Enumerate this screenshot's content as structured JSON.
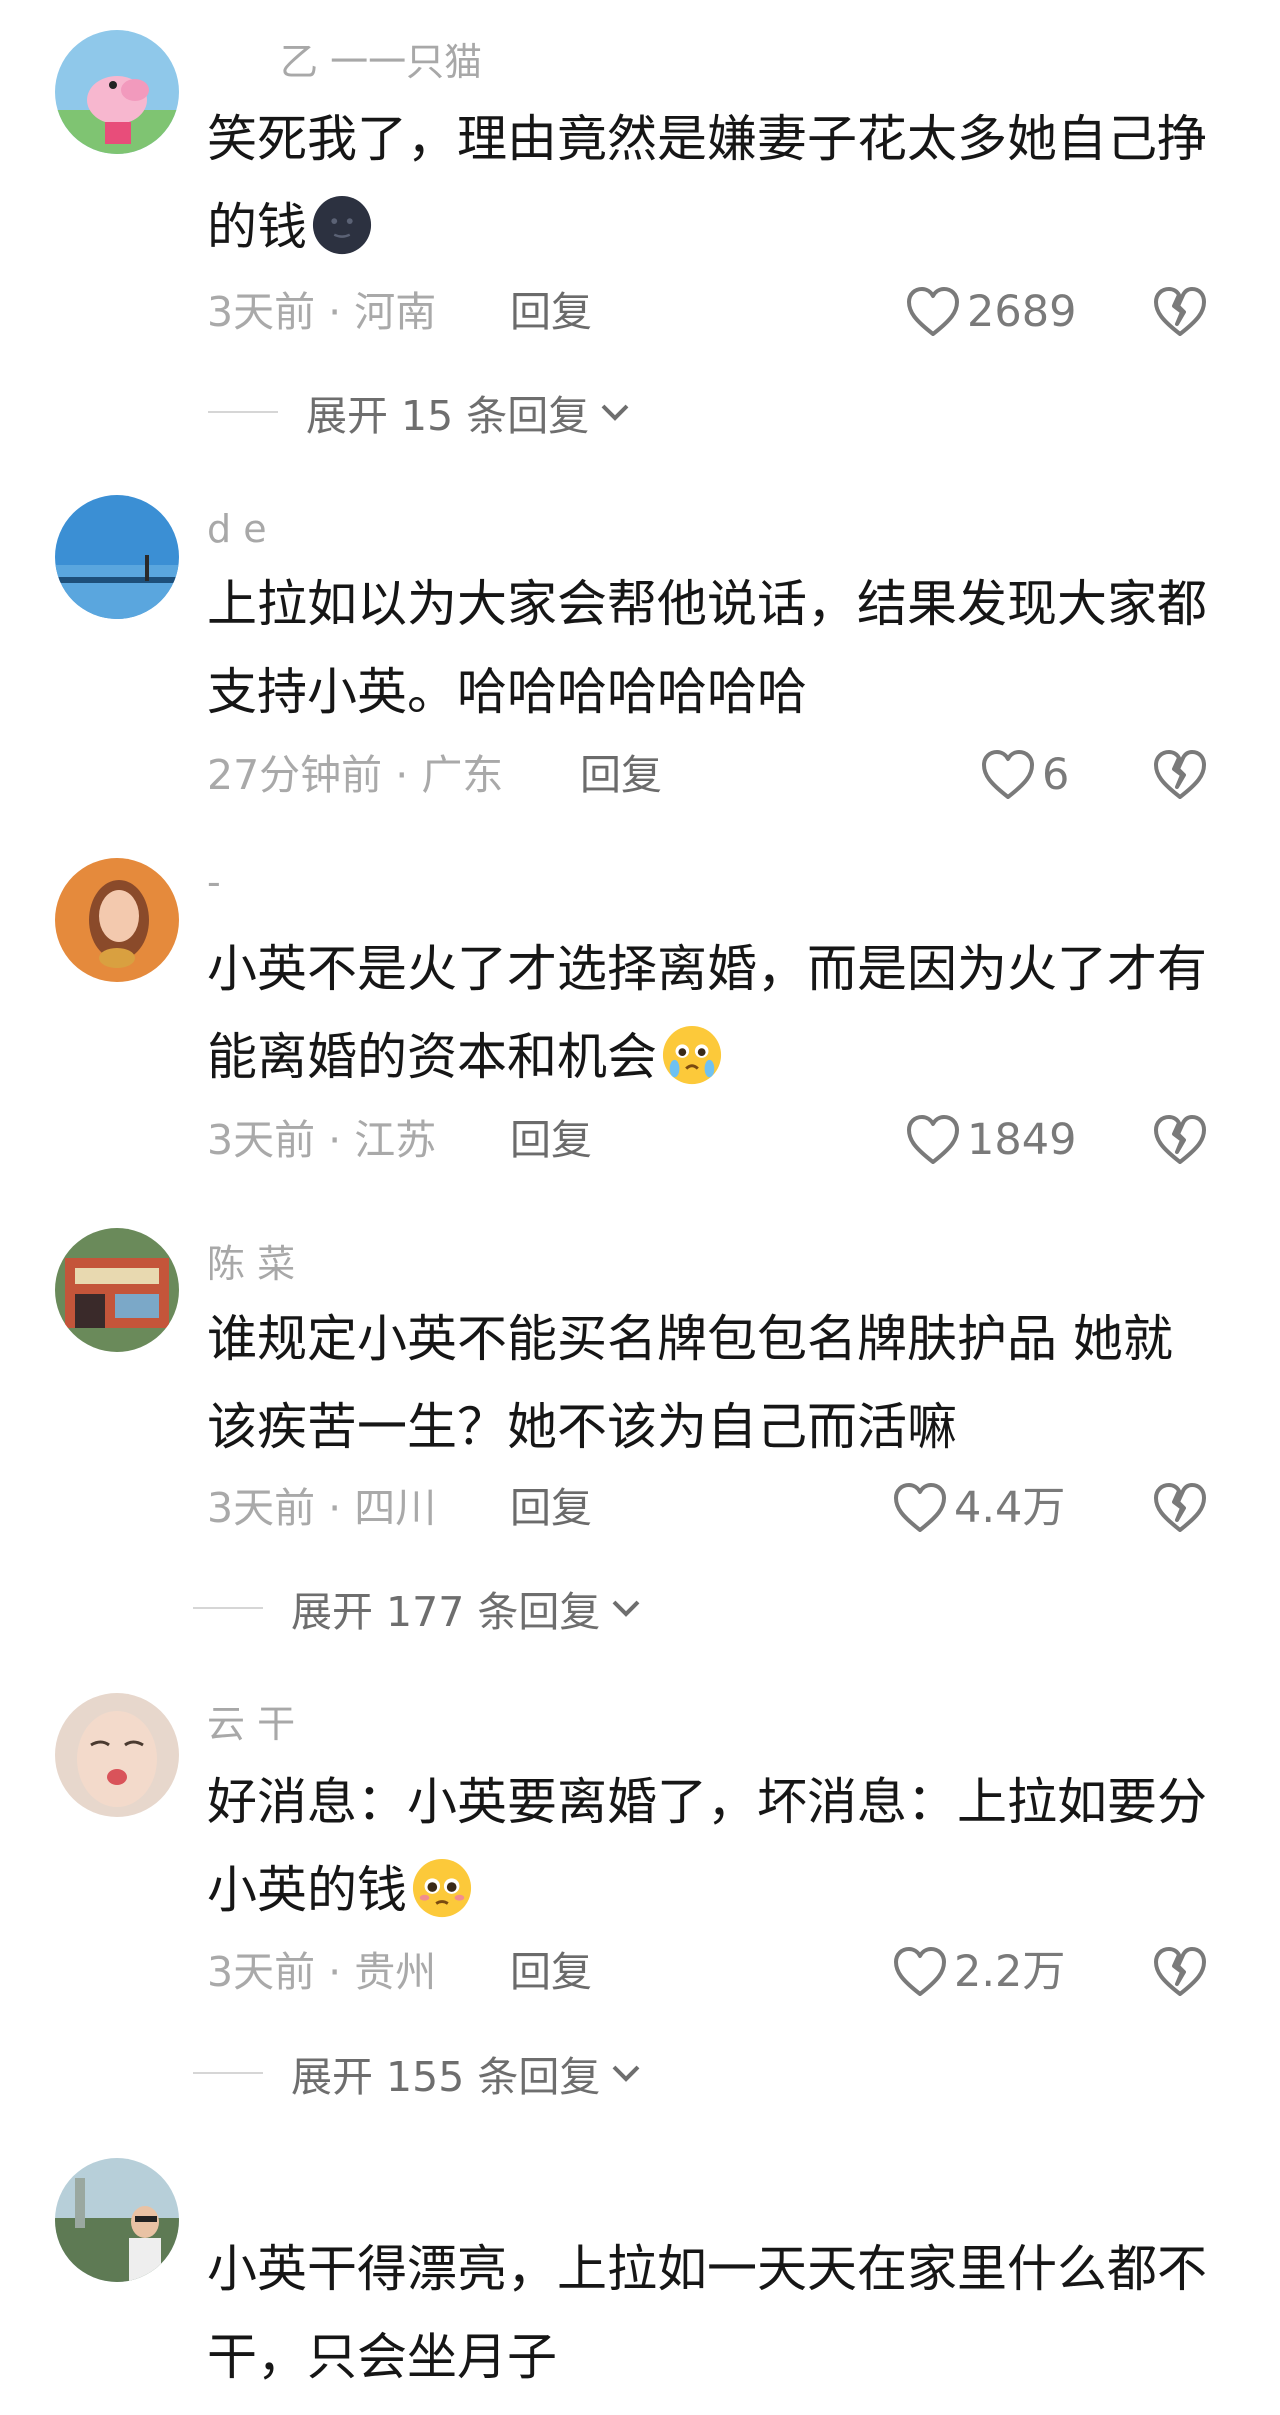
{
  "comments": [
    {
      "username": "乙 一一只猫",
      "text": "笑死我了，理由竟然是嫌妻子花太多她自己挣的钱",
      "emoji": "new-moon-face",
      "time": "3天前",
      "location": "河南",
      "reply_label": "回复",
      "likes": "2689",
      "expand_label": "展开 15 条回复"
    },
    {
      "username": "d e",
      "text": "上拉如以为大家会帮他说话，结果发现大家都支持小英。哈哈哈哈哈哈哈",
      "time": "27分钟前",
      "location": "广东",
      "reply_label": "回复",
      "likes": "6"
    },
    {
      "username": "-",
      "text": "小英不是火了才选择离婚，而是因为火了才有能离婚的资本和机会",
      "emoji": "crying-pleading-face",
      "time": "3天前",
      "location": "江苏",
      "reply_label": "回复",
      "likes": "1849"
    },
    {
      "username": "陈 菜",
      "text": "谁规定小英不能买名牌包包名牌肤护品 她就该疾苦一生？她不该为自己而活嘛",
      "time": "3天前",
      "location": "四川",
      "reply_label": "回复",
      "likes": "4.4万",
      "expand_label": "展开 177 条回复"
    },
    {
      "username": "云 干",
      "text": "好消息：小英要离婚了，坏消息：上拉如要分小英的钱",
      "emoji": "pleading-face",
      "time": "3天前",
      "location": "贵州",
      "reply_label": "回复",
      "likes": "2.2万",
      "expand_label": "展开 155 条回复"
    },
    {
      "text": "小英干得漂亮，上拉如一天天在家里什么都不干，只会坐月子"
    }
  ],
  "separator": "·",
  "colors": {
    "meta": "#a9a9a9",
    "text": "#161616",
    "username": "#a8a8a8"
  }
}
